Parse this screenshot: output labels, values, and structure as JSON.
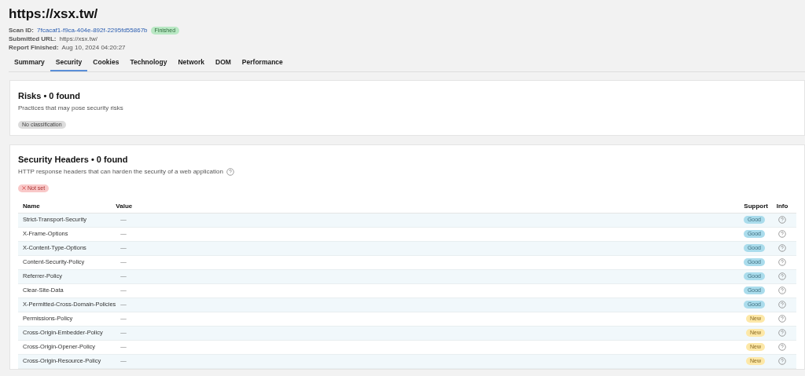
{
  "title": "https://xsx.tw/",
  "meta": {
    "scan_id_label": "Scan ID:",
    "scan_id": "7fcacaf1-f9ca-404e-892f-2295fd55867b",
    "status": "Finished",
    "submitted_label": "Submitted URL:",
    "submitted": "https://xsx.tw/",
    "finished_label": "Report Finished:",
    "finished": "Aug 10, 2024 04:20:27"
  },
  "tabs": [
    {
      "label": "Summary",
      "selected": false
    },
    {
      "label": "Security",
      "selected": true
    },
    {
      "label": "Cookies",
      "selected": false
    },
    {
      "label": "Technology",
      "selected": false
    },
    {
      "label": "Network",
      "selected": false
    },
    {
      "label": "DOM",
      "selected": false
    },
    {
      "label": "Performance",
      "selected": false
    }
  ],
  "risks": {
    "heading": "Risks • 0 found",
    "description": "Practices that may pose security risks",
    "badge": "No classification"
  },
  "headers": {
    "heading": "Security Headers • 0 found",
    "description": "HTTP response headers that can harden the security of a web application",
    "badge": "Not set",
    "columns": [
      "Name",
      "Value",
      "Support",
      "Info"
    ],
    "rows": [
      {
        "name": "Strict-Transport-Security",
        "value": "—",
        "support": "Good",
        "kind": "good"
      },
      {
        "name": "X-Frame-Options",
        "value": "—",
        "support": "Good",
        "kind": "good"
      },
      {
        "name": "X-Content-Type-Options",
        "value": "—",
        "support": "Good",
        "kind": "good"
      },
      {
        "name": "Content-Security-Policy",
        "value": "—",
        "support": "Good",
        "kind": "good"
      },
      {
        "name": "Referrer-Policy",
        "value": "—",
        "support": "Good",
        "kind": "good"
      },
      {
        "name": "Clear-Site-Data",
        "value": "—",
        "support": "Good",
        "kind": "good"
      },
      {
        "name": "X-Permitted-Cross-Domain-Policies",
        "value": "—",
        "support": "Good",
        "kind": "good"
      },
      {
        "name": "Permissions-Policy",
        "value": "—",
        "support": "New",
        "kind": "new"
      },
      {
        "name": "Cross-Origin-Embedder-Policy",
        "value": "—",
        "support": "New",
        "kind": "new"
      },
      {
        "name": "Cross-Origin-Opener-Policy",
        "value": "—",
        "support": "New",
        "kind": "new"
      },
      {
        "name": "Cross-Origin-Resource-Policy",
        "value": "—",
        "support": "New",
        "kind": "new"
      }
    ]
  }
}
